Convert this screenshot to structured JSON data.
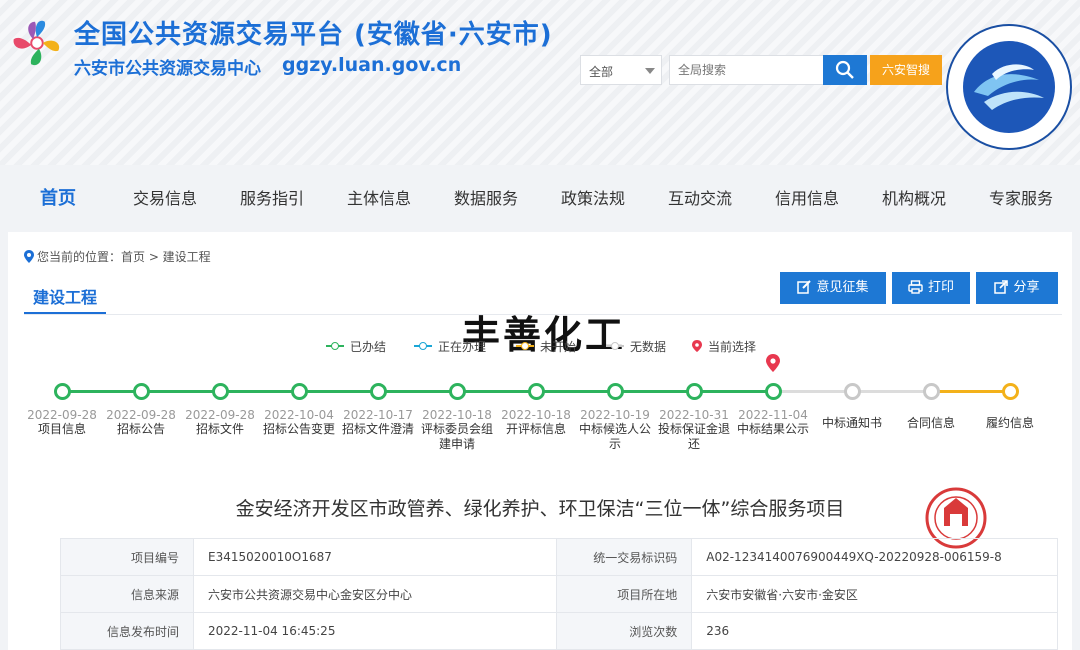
{
  "header": {
    "title": "全国公共资源交易平台 (安徽省·六安市)",
    "subtitle": "六安市公共资源交易中心",
    "domain": "ggzy.luan.gov.cn",
    "search_scope": "全部",
    "search_placeholder": "全局搜索",
    "smart_label": "六安智搜"
  },
  "nav": [
    "首页",
    "交易信息",
    "服务指引",
    "主体信息",
    "数据服务",
    "政策法规",
    "互动交流",
    "信用信息",
    "机构概况",
    "专家服务"
  ],
  "breadcrumb": "您当前的位置：首页 > 建设工程",
  "tab_title": "建设工程",
  "actions": {
    "feedback": "意见征集",
    "print": "打印",
    "share": "分享"
  },
  "watermark": "丰善化工",
  "legend": [
    {
      "label": "已办结",
      "color": "#2db35d"
    },
    {
      "label": "正在办理",
      "color": "#1aa6d6"
    },
    {
      "label": "未开始",
      "color": "#f3b11a"
    },
    {
      "label": "无数据",
      "color": "#c8c8c8"
    },
    {
      "label": "当前选择",
      "color": "#e8384f"
    }
  ],
  "timeline": [
    {
      "date": "2022-09-28",
      "label": "项目信息",
      "status": "done"
    },
    {
      "date": "2022-09-28",
      "label": "招标公告",
      "status": "done"
    },
    {
      "date": "2022-09-28",
      "label": "招标文件",
      "status": "done"
    },
    {
      "date": "2022-10-04",
      "label": "招标公告变更",
      "status": "done"
    },
    {
      "date": "2022-10-17",
      "label": "招标文件澄清",
      "status": "done"
    },
    {
      "date": "2022-10-18",
      "label": "评标委员会组建申请",
      "status": "done"
    },
    {
      "date": "2022-10-18",
      "label": "开评标信息",
      "status": "done"
    },
    {
      "date": "2022-10-19",
      "label": "中标候选人公示",
      "status": "done"
    },
    {
      "date": "2022-10-31",
      "label": "投标保证金退还",
      "status": "done"
    },
    {
      "date": "2022-11-04",
      "label": "中标结果公示",
      "status": "current"
    },
    {
      "date": "",
      "label": "中标通知书",
      "status": "nodata"
    },
    {
      "date": "",
      "label": "合同信息",
      "status": "nodata"
    },
    {
      "date": "",
      "label": "履约信息",
      "status": "pending"
    }
  ],
  "project": {
    "title": "金安经济开发区市政管养、绿化养护、环卫保洁“三位一体”综合服务项目",
    "rows": [
      {
        "k1": "项目编号",
        "v1": "E3415020010O1687",
        "k2": "统一交易标识码",
        "v2": "A02-1234140076900449XQ-20220928-006159-8"
      },
      {
        "k1": "信息来源",
        "v1": "六安市公共资源交易中心金安区分中心",
        "k2": "项目所在地",
        "v2": "六安市安徽省·六安市·金安区"
      },
      {
        "k1": "信息发布时间",
        "v1": "2022-11-04 16:45:25",
        "k2": "浏览次数",
        "v2": "236"
      }
    ]
  }
}
